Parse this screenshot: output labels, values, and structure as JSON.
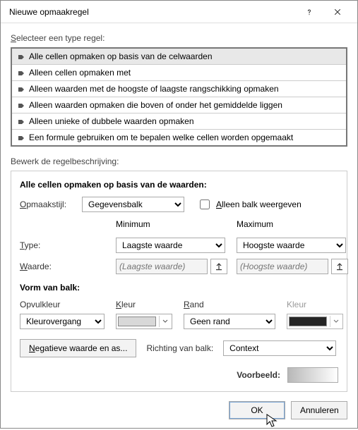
{
  "title": "Nieuwe opmaakregel",
  "section_select_label": "Selecteer een type regel:",
  "rule_types": [
    "Alle cellen opmaken op basis van de celwaarden",
    "Alleen cellen opmaken met",
    "Alleen waarden met de hoogste of laagste rangschikking opmaken",
    "Alleen waarden opmaken die boven of onder het gemiddelde liggen",
    "Alleen unieke of dubbele waarden opmaken",
    "Een formule gebruiken om te bepalen welke cellen worden opgemaakt"
  ],
  "section_edit_label": "Bewerk de regelbeschrijving:",
  "desc_title": "Alle cellen opmaken op basis van de waarden:",
  "format_style_label": "Opmaakstijl:",
  "format_style_value": "Gegevensbalk",
  "show_bar_only_label": "Alleen balk weergeven",
  "min_label": "Minimum",
  "max_label": "Maximum",
  "type_label": "Type:",
  "value_label": "Waarde:",
  "min_type_value": "Laagste waarde",
  "max_type_value": "Hoogste waarde",
  "min_value_placeholder": "(Laagste waarde)",
  "max_value_placeholder": "(Hoogste waarde)",
  "bar_appearance_label": "Vorm van balk:",
  "fill_label": "Opvulkleur",
  "color_label": "Kleur",
  "border_label": "Rand",
  "border_color_label": "Kleur",
  "fill_value": "Kleurovergang",
  "border_value": "Geen rand",
  "fill_color": "#d8d8d8",
  "border_color": "#000000",
  "negative_button": "Negatieve waarde en as...",
  "direction_label": "Richting van balk:",
  "direction_value": "Context",
  "preview_label": "Voorbeeld:",
  "ok_label": "OK",
  "cancel_label": "Annuleren"
}
